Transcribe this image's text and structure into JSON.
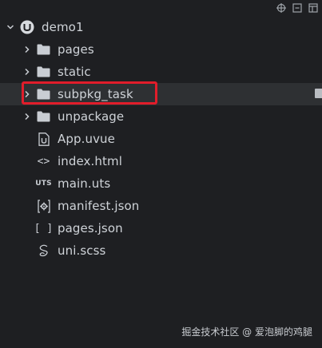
{
  "toolbar": {
    "icons": [
      "crosshair-icon",
      "collapse-all-icon",
      "layout-icon"
    ]
  },
  "tree": {
    "root": {
      "label": "demo1",
      "icon": "uniapp-logo-icon",
      "expanded": true
    },
    "items": [
      {
        "label": "pages",
        "type": "folder",
        "expandable": true
      },
      {
        "label": "static",
        "type": "folder",
        "expandable": true
      },
      {
        "label": "subpkg_task",
        "type": "folder",
        "expandable": true,
        "selected": true
      },
      {
        "label": "unpackage",
        "type": "folder",
        "expandable": true
      },
      {
        "label": "App.uvue",
        "type": "file",
        "icon": "vue-file-icon"
      },
      {
        "label": "index.html",
        "type": "file",
        "icon": "html-file-icon"
      },
      {
        "label": "main.uts",
        "type": "file",
        "icon": "uts-file-icon"
      },
      {
        "label": "manifest.json",
        "type": "file",
        "icon": "manifest-file-icon"
      },
      {
        "label": "pages.json",
        "type": "file",
        "icon": "json-file-icon"
      },
      {
        "label": "uni.scss",
        "type": "file",
        "icon": "scss-file-icon"
      }
    ]
  },
  "icon_glyphs": {
    "uts": "UTS",
    "html": "<>",
    "json": "[ ]"
  },
  "watermark": "掘金技术社区 @ 爱泡脚的鸡腿",
  "colors": {
    "background": "#1e1f22",
    "selected_row": "#2e3033",
    "highlight_border": "#e11d2b",
    "text": "#cfd3d8"
  }
}
